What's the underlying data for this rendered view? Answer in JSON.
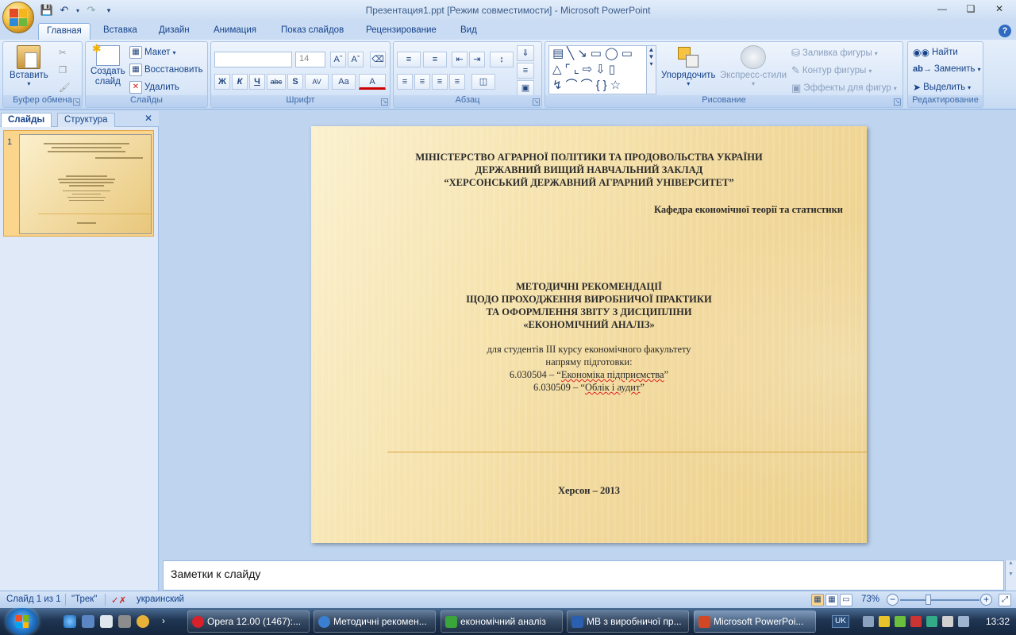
{
  "window": {
    "title": "Презентация1.ppt [Режим совместимости] - Microsoft PowerPoint"
  },
  "tabs": [
    "Главная",
    "Вставка",
    "Дизайн",
    "Анимация",
    "Показ слайдов",
    "Рецензирование",
    "Вид"
  ],
  "ribbon": {
    "clipboard": {
      "label": "Буфер обмена",
      "paste": "Вставить"
    },
    "slides": {
      "label": "Слайды",
      "new_slide_line1": "Создать",
      "new_slide_line2": "слайд",
      "layout": "Макет",
      "reset": "Восстановить",
      "delete": "Удалить"
    },
    "font": {
      "label": "Шрифт",
      "font_name": "",
      "font_size": "14",
      "bold": "Ж",
      "italic": "К",
      "underline": "Ч",
      "strike": "abc",
      "shadow": "S",
      "spacing": "AV",
      "case": "Aa",
      "color": "A"
    },
    "paragraph": {
      "label": "Абзац"
    },
    "drawing": {
      "label": "Рисование",
      "arrange": "Упорядочить",
      "quick_styles": "Экспресс-стили",
      "fill": "Заливка фигуры",
      "outline": "Контур фигуры",
      "effects": "Эффекты для фигур"
    },
    "editing": {
      "label": "Редактирование",
      "find": "Найти",
      "replace": "Заменить",
      "select": "Выделить"
    }
  },
  "left_panel": {
    "tab_slides": "Слайды",
    "tab_outline": "Структура",
    "slide_number": "1"
  },
  "slide": {
    "header_line1": "МІНІСТЕРСТВО АГРАРНОЇ ПОЛІТИКИ ТА ПРОДОВОЛЬСТВА УКРАЇНИ",
    "header_line2": "ДЕРЖАВНИЙ ВИЩИЙ НАВЧАЛЬНИЙ ЗАКЛАД",
    "header_line3": "“ХЕРСОНСЬКИЙ ДЕРЖАВНИЙ АГРАРНИЙ УНІВЕРСИТЕТ”",
    "department": "Кафедра економічної теорії та статистики",
    "title_line1": "МЕТОДИЧНІ РЕКОМЕНДАЦІЇ",
    "title_line2": "ЩОДО ПРОХОДЖЕННЯ ВИРОБНИЧОЇ ПРАКТИКИ",
    "title_line3": "ТА ОФОРМЛЕННЯ ЗВІТУ З ДИСЦИПЛІНИ",
    "title_line4": "«ЕКОНОМІЧНИЙ АНАЛІЗ»",
    "sub_line1": "для студентів ІІІ курсу  економічного факультету",
    "sub_line2": "напряму підготовки:",
    "sub_line3_code": "6.030504 – “",
    "sub_line3_name": "Економіка підприємства",
    "sub_line3_end": "”",
    "sub_line4_code": "6.030509 – “",
    "sub_line4_name": "Облік і аудит",
    "sub_line4_end": "”",
    "footer": "Херсон – 2013"
  },
  "notes": {
    "placeholder": "Заметки к слайду"
  },
  "status": {
    "slide_info": "Слайд 1 из 1",
    "theme": "\"Трек\"",
    "language": "украинский",
    "zoom": "73%",
    "zoom_level": 0.73
  },
  "taskbar": {
    "items": [
      {
        "label": "Opera 12.00 (1467):...",
        "color": "#d8212a"
      },
      {
        "label": "Методичні рекомен...",
        "color": "#3b7fd0"
      },
      {
        "label": "економічний аналіз",
        "color": "#3aa53a"
      },
      {
        "label": "МВ з виробничої пр...",
        "color": "#2b5fb0"
      },
      {
        "label": "Microsoft PowerPoi...",
        "color": "#d24726"
      }
    ],
    "lang": "UK",
    "time": "13:32"
  }
}
